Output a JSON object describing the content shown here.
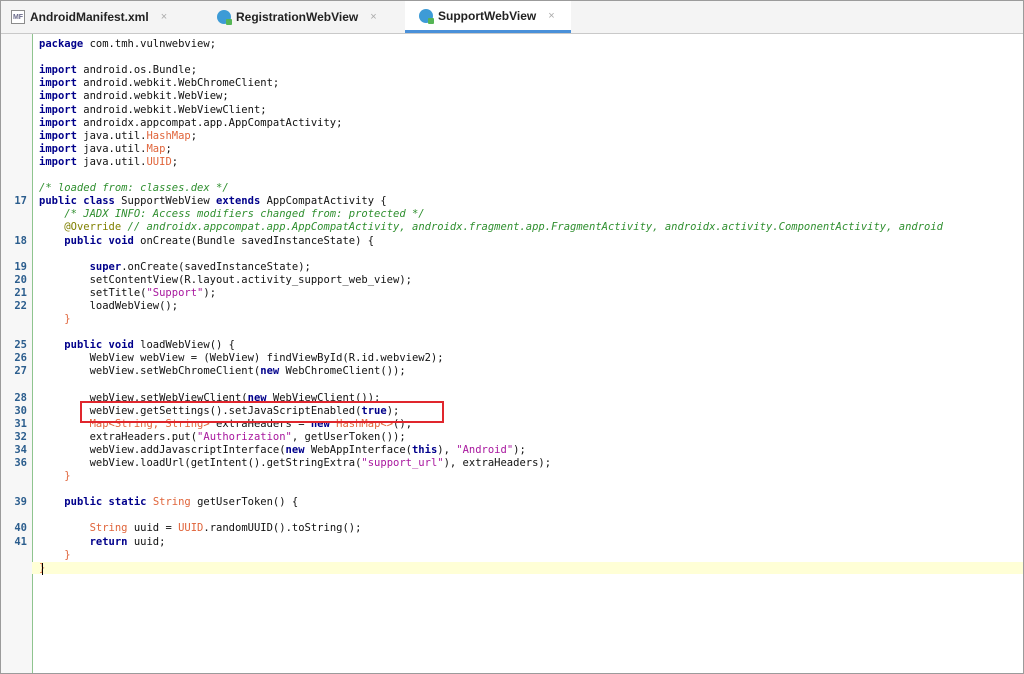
{
  "tabs": [
    {
      "label": "AndroidManifest.xml",
      "icon": "manifest-file-icon",
      "icon_text": "MF",
      "active": false,
      "close": "×"
    },
    {
      "label": "RegistrationWebView",
      "icon": "java-class-icon",
      "active": false,
      "close": "×"
    },
    {
      "label": "SupportWebView",
      "icon": "java-class-icon",
      "active": true,
      "close": "×"
    }
  ],
  "colors": {
    "keyword": "#00008b",
    "type": "#e0643a",
    "string": "#a8179e",
    "comment": "#2f8f2f",
    "annotation": "#808000",
    "line_number": "#2b5d8d",
    "highlight_box": "#e0262d",
    "active_tab_underline": "#4a90d9"
  },
  "code_lines": [
    {
      "ln": "",
      "tokens": [
        [
          "k",
          "package"
        ],
        [
          "p",
          " com.tmh.vulnwebview;"
        ]
      ]
    },
    {
      "ln": "",
      "tokens": []
    },
    {
      "ln": "",
      "tokens": [
        [
          "k",
          "import"
        ],
        [
          "p",
          " android.os.Bundle;"
        ]
      ]
    },
    {
      "ln": "",
      "tokens": [
        [
          "k",
          "import"
        ],
        [
          "p",
          " android.webkit.WebChromeClient;"
        ]
      ]
    },
    {
      "ln": "",
      "tokens": [
        [
          "k",
          "import"
        ],
        [
          "p",
          " android.webkit.WebView;"
        ]
      ]
    },
    {
      "ln": "",
      "tokens": [
        [
          "k",
          "import"
        ],
        [
          "p",
          " android.webkit.WebViewClient;"
        ]
      ]
    },
    {
      "ln": "",
      "tokens": [
        [
          "k",
          "import"
        ],
        [
          "p",
          " androidx.appcompat.app.AppCompatActivity;"
        ]
      ]
    },
    {
      "ln": "",
      "tokens": [
        [
          "k",
          "import"
        ],
        [
          "p",
          " java.util."
        ],
        [
          "t",
          "HashMap"
        ],
        [
          "p",
          ";"
        ]
      ]
    },
    {
      "ln": "",
      "tokens": [
        [
          "k",
          "import"
        ],
        [
          "p",
          " java.util."
        ],
        [
          "t",
          "Map"
        ],
        [
          "p",
          ";"
        ]
      ]
    },
    {
      "ln": "",
      "tokens": [
        [
          "k",
          "import"
        ],
        [
          "p",
          " java.util."
        ],
        [
          "t",
          "UUID"
        ],
        [
          "p",
          ";"
        ]
      ]
    },
    {
      "ln": "",
      "tokens": []
    },
    {
      "ln": "",
      "tokens": [
        [
          "c",
          "/* loaded from: classes.dex */"
        ]
      ]
    },
    {
      "ln": "17",
      "tokens": [
        [
          "k",
          "public class"
        ],
        [
          "p",
          " SupportWebView "
        ],
        [
          "k",
          "extends"
        ],
        [
          "p",
          " AppCompatActivity {"
        ]
      ]
    },
    {
      "ln": "",
      "tokens": [
        [
          "p",
          "    "
        ],
        [
          "c",
          "/* JADX INFO: Access modifiers changed from: protected */"
        ]
      ]
    },
    {
      "ln": "",
      "tokens": [
        [
          "p",
          "    "
        ],
        [
          "a",
          "@Override"
        ],
        [
          "c",
          " // androidx.appcompat.app.AppCompatActivity, androidx.fragment.app.FragmentActivity, androidx.activity.ComponentActivity, android"
        ]
      ]
    },
    {
      "ln": "18",
      "tokens": [
        [
          "p",
          "    "
        ],
        [
          "k",
          "public void"
        ],
        [
          "p",
          " onCreate(Bundle savedInstanceState) {"
        ]
      ]
    },
    {
      "ln": "19",
      "tokens": [
        [
          "p",
          "        "
        ],
        [
          "k",
          "super"
        ],
        [
          "p",
          ".onCreate(savedInstanceState);"
        ]
      ]
    },
    {
      "ln": "20",
      "tokens": [
        [
          "p",
          "        setContentView(R.layout.activity_support_web_view);"
        ]
      ]
    },
    {
      "ln": "21",
      "tokens": [
        [
          "p",
          "        setTitle("
        ],
        [
          "s",
          "\"Support\""
        ],
        [
          "p",
          ");"
        ]
      ]
    },
    {
      "ln": "22",
      "tokens": [
        [
          "p",
          "        loadWebView();"
        ]
      ]
    },
    {
      "ln": "",
      "tokens": [
        [
          "p",
          "    "
        ],
        [
          "t",
          "}"
        ]
      ]
    },
    {
      "ln": "",
      "tokens": []
    },
    {
      "ln": "25",
      "tokens": [
        [
          "p",
          "    "
        ],
        [
          "k",
          "public void"
        ],
        [
          "p",
          " loadWebView() {"
        ]
      ]
    },
    {
      "ln": "26",
      "tokens": [
        [
          "p",
          "        WebView webView = (WebView) findViewById(R.id.webview2);"
        ]
      ]
    },
    {
      "ln": "27",
      "tokens": [
        [
          "p",
          "        webView.setWebChromeClient("
        ],
        [
          "k",
          "new"
        ],
        [
          "p",
          " WebChromeClient());"
        ]
      ]
    },
    {
      "ln": "28",
      "tokens": [
        [
          "p",
          "        webView.setWebViewClient("
        ],
        [
          "k",
          "new"
        ],
        [
          "p",
          " WebViewClient());"
        ]
      ]
    },
    {
      "ln": "30",
      "tokens": [
        [
          "p",
          "        webView.getSettings().setJavaScriptEnabled("
        ],
        [
          "k",
          "true"
        ],
        [
          "p",
          ");"
        ]
      ]
    },
    {
      "ln": "31",
      "tokens": [
        [
          "p",
          "        "
        ],
        [
          "t",
          "Map<String, String>"
        ],
        [
          "p",
          " extraHeaders = "
        ],
        [
          "k",
          "new"
        ],
        [
          "p",
          " "
        ],
        [
          "t",
          "HashMap<>"
        ],
        [
          "p",
          "();"
        ]
      ]
    },
    {
      "ln": "32",
      "tokens": [
        [
          "p",
          "        extraHeaders.put("
        ],
        [
          "s",
          "\"Authorization\""
        ],
        [
          "p",
          ", getUserToken());"
        ]
      ]
    },
    {
      "ln": "34",
      "tokens": [
        [
          "p",
          "        webView.addJavascriptInterface("
        ],
        [
          "k",
          "new"
        ],
        [
          "p",
          " WebAppInterface("
        ],
        [
          "k",
          "this"
        ],
        [
          "p",
          "), "
        ],
        [
          "s",
          "\"Android\""
        ],
        [
          "p",
          ");"
        ]
      ]
    },
    {
      "ln": "36",
      "tokens": [
        [
          "p",
          "        webView.loadUrl(getIntent().getStringExtra("
        ],
        [
          "s",
          "\"support_url\""
        ],
        [
          "p",
          "), extraHeaders);"
        ]
      ]
    },
    {
      "ln": "",
      "tokens": [
        [
          "p",
          "    "
        ],
        [
          "t",
          "}"
        ]
      ]
    },
    {
      "ln": "",
      "tokens": []
    },
    {
      "ln": "39",
      "tokens": [
        [
          "p",
          "    "
        ],
        [
          "k",
          "public static"
        ],
        [
          "p",
          " "
        ],
        [
          "t",
          "String"
        ],
        [
          "p",
          " getUserToken() {"
        ]
      ]
    },
    {
      "ln": "40",
      "tokens": [
        [
          "p",
          "        "
        ],
        [
          "t",
          "String"
        ],
        [
          "p",
          " uuid = "
        ],
        [
          "t",
          "UUID"
        ],
        [
          "p",
          ".randomUUID().toString();"
        ]
      ]
    },
    {
      "ln": "41",
      "tokens": [
        [
          "p",
          "        "
        ],
        [
          "k",
          "return"
        ],
        [
          "p",
          " uuid;"
        ]
      ]
    },
    {
      "ln": "",
      "tokens": [
        [
          "p",
          "    "
        ],
        [
          "t",
          "}"
        ]
      ]
    },
    {
      "ln": "",
      "tokens": [
        [
          "t",
          "}"
        ]
      ]
    }
  ]
}
